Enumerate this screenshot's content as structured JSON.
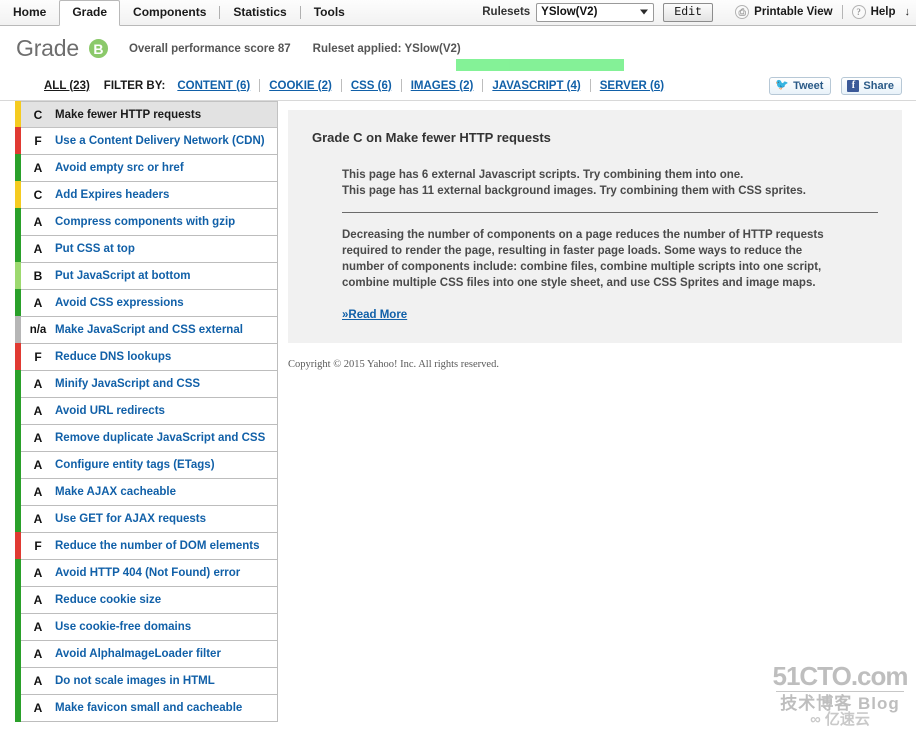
{
  "toolbar": {
    "tabs": [
      {
        "label": "Home",
        "active": false
      },
      {
        "label": "Grade",
        "active": true
      },
      {
        "label": "Components",
        "active": false
      },
      {
        "label": "Statistics",
        "active": false
      },
      {
        "label": "Tools",
        "active": false
      }
    ],
    "rulesets_label": "Rulesets",
    "ruleset_value": "YSlow(V2)",
    "edit_label": "Edit",
    "printable_view_label": "Printable View",
    "printable_icon": "printer-icon",
    "help_label": "Help",
    "help_icon": "question-mark-icon",
    "help_arrow": "↓"
  },
  "header": {
    "title": "Grade",
    "badge_grade": "B",
    "badge_color": "#8bc96a",
    "overall_score_text": "Overall performance score 87",
    "ruleset_applied_text": "Ruleset applied: YSlow(V2)",
    "highlight_color": "#62ee7a"
  },
  "filterbar": {
    "all_label": "ALL (23)",
    "filter_by_label": "FILTER BY:",
    "filters": [
      {
        "label": "CONTENT (6)"
      },
      {
        "label": "COOKIE (2)"
      },
      {
        "label": "CSS (6)"
      },
      {
        "label": "IMAGES (2)"
      },
      {
        "label": "JAVASCRIPT (4)"
      },
      {
        "label": "SERVER (6)"
      }
    ],
    "tweet_label": "Tweet",
    "share_label": "Share",
    "tweet_icon": "twitter-bird-icon",
    "share_icon": "facebook-f-icon"
  },
  "colors": {
    "grade_a": "#2aa02a",
    "grade_b": "#9dd96f",
    "grade_c": "#f5cb20",
    "grade_f": "#e03a32",
    "grade_na": "#b6b6b6",
    "link": "#1160a8"
  },
  "rules": [
    {
      "grade": "C",
      "name": "Make fewer HTTP requests",
      "stripe": "#f5cb20",
      "selected": true
    },
    {
      "grade": "F",
      "name": "Use a Content Delivery Network (CDN)",
      "stripe": "#e03a32",
      "selected": false
    },
    {
      "grade": "A",
      "name": "Avoid empty src or href",
      "stripe": "#2aa02a",
      "selected": false
    },
    {
      "grade": "C",
      "name": "Add Expires headers",
      "stripe": "#f5cb20",
      "selected": false
    },
    {
      "grade": "A",
      "name": "Compress components with gzip",
      "stripe": "#2aa02a",
      "selected": false
    },
    {
      "grade": "A",
      "name": "Put CSS at top",
      "stripe": "#2aa02a",
      "selected": false
    },
    {
      "grade": "B",
      "name": "Put JavaScript at bottom",
      "stripe": "#9dd96f",
      "selected": false
    },
    {
      "grade": "A",
      "name": "Avoid CSS expressions",
      "stripe": "#2aa02a",
      "selected": false
    },
    {
      "grade": "n/a",
      "name": "Make JavaScript and CSS external",
      "stripe": "#b6b6b6",
      "selected": false
    },
    {
      "grade": "F",
      "name": "Reduce DNS lookups",
      "stripe": "#e03a32",
      "selected": false
    },
    {
      "grade": "A",
      "name": "Minify JavaScript and CSS",
      "stripe": "#2aa02a",
      "selected": false
    },
    {
      "grade": "A",
      "name": "Avoid URL redirects",
      "stripe": "#2aa02a",
      "selected": false
    },
    {
      "grade": "A",
      "name": "Remove duplicate JavaScript and CSS",
      "stripe": "#2aa02a",
      "selected": false
    },
    {
      "grade": "A",
      "name": "Configure entity tags (ETags)",
      "stripe": "#2aa02a",
      "selected": false
    },
    {
      "grade": "A",
      "name": "Make AJAX cacheable",
      "stripe": "#2aa02a",
      "selected": false
    },
    {
      "grade": "A",
      "name": "Use GET for AJAX requests",
      "stripe": "#2aa02a",
      "selected": false
    },
    {
      "grade": "F",
      "name": "Reduce the number of DOM elements",
      "stripe": "#e03a32",
      "selected": false
    },
    {
      "grade": "A",
      "name": "Avoid HTTP 404 (Not Found) error",
      "stripe": "#2aa02a",
      "selected": false
    },
    {
      "grade": "A",
      "name": "Reduce cookie size",
      "stripe": "#2aa02a",
      "selected": false
    },
    {
      "grade": "A",
      "name": "Use cookie-free domains",
      "stripe": "#2aa02a",
      "selected": false
    },
    {
      "grade": "A",
      "name": "Avoid AlphaImageLoader filter",
      "stripe": "#2aa02a",
      "selected": false
    },
    {
      "grade": "A",
      "name": "Do not scale images in HTML",
      "stripe": "#2aa02a",
      "selected": false
    },
    {
      "grade": "A",
      "name": "Make favicon small and cacheable",
      "stripe": "#2aa02a",
      "selected": false
    }
  ],
  "detail": {
    "title": "Grade C on Make fewer HTTP requests",
    "finding_1": "This page has 6 external Javascript scripts. Try combining them into one.",
    "finding_2": "This page has 11 external background images. Try combining them with CSS sprites.",
    "description": "Decreasing the number of components on a page reduces the number of HTTP requests required to render the page, resulting in faster page loads. Some ways to reduce the number of components include: combine files, combine multiple scripts into one script, combine multiple CSS files into one style sheet, and use CSS Sprites and image maps.",
    "read_more_label": "»Read More"
  },
  "footer": {
    "copyright": "Copyright © 2015 Yahoo! Inc. All rights reserved."
  },
  "watermark": {
    "main": "51CTO.com",
    "sub": "技术博客  Blog",
    "cloud": "∞ 亿速云"
  }
}
